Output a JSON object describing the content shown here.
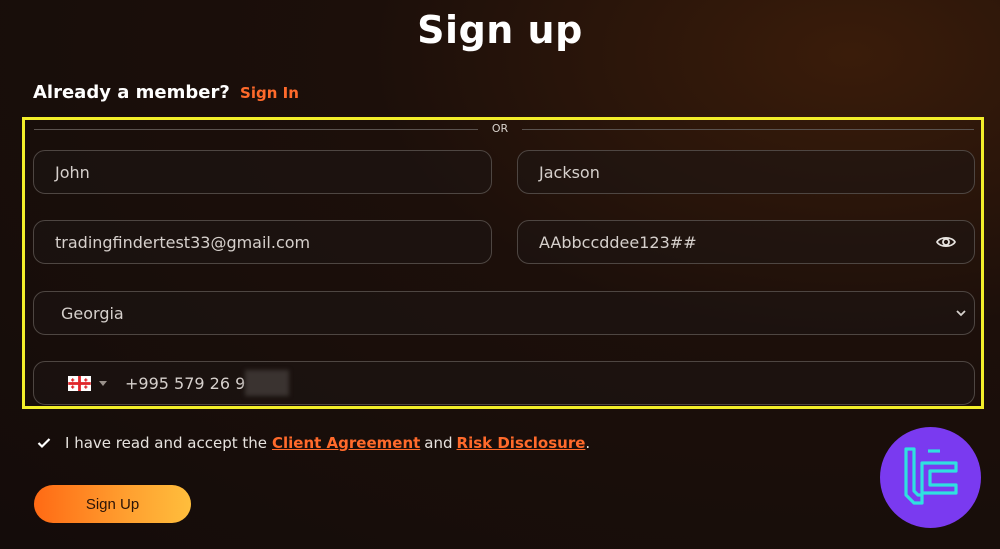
{
  "page": {
    "title": "Sign up"
  },
  "member": {
    "prompt": "Already a member?",
    "signin_link": "Sign In"
  },
  "divider": {
    "text": "OR"
  },
  "form": {
    "first_name": "John",
    "last_name": "Jackson",
    "email": "tradingfindertest33@gmail.com",
    "password": "AAbbccddee123##",
    "country": "Georgia",
    "phone": "+995 579 26 9"
  },
  "agreement": {
    "text_before": "I have read and accept the",
    "client_agreement": "Client Agreement",
    "and": "and",
    "risk_disclosure": "Risk Disclosure",
    "period": "."
  },
  "buttons": {
    "signup": "Sign Up"
  },
  "icons": {
    "password_toggle": "eye-icon",
    "country_dropdown": "chevron-down-icon",
    "phone_flag": "georgia-flag-icon",
    "checkbox": "checkmark-icon",
    "brand": "tradingfinder-logo"
  },
  "colors": {
    "accent": "#ff6a2b",
    "highlight": "#f2ee2a",
    "logo_bg": "#7a3af0",
    "logo_fg": "#2fe0e0"
  }
}
